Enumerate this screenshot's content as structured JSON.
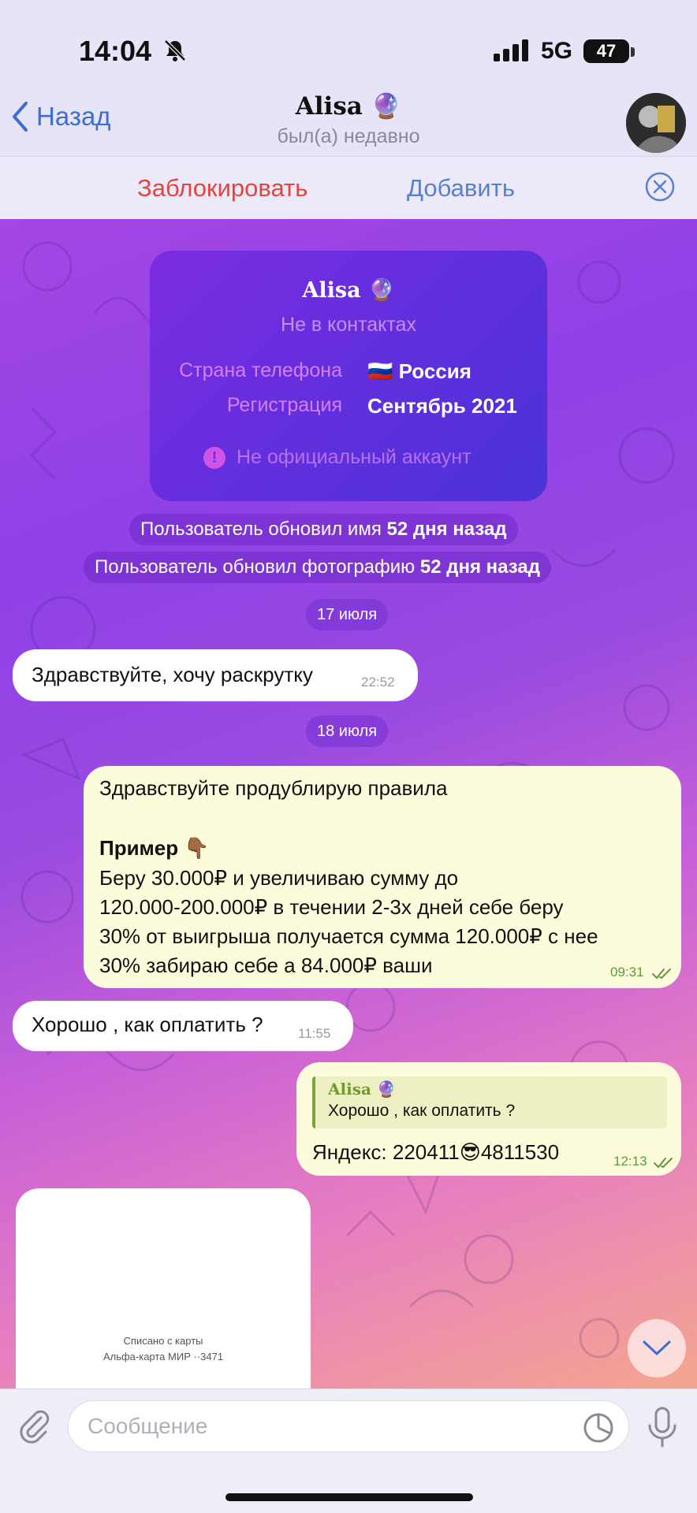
{
  "status_bar": {
    "time": "14:04",
    "network": "5G",
    "battery": "47"
  },
  "header": {
    "back_label": "Назад",
    "contact_name": "Alisa 🔮",
    "contact_status": "был(а) недавно"
  },
  "action_bar": {
    "block_label": "Заблокировать",
    "add_label": "Добавить"
  },
  "info_card": {
    "name": "Alisa 🔮",
    "subtitle": "Не в контактах",
    "phone_country_label": "Страна телефона",
    "phone_country_value": "🇷🇺 Россия",
    "registration_label": "Регистрация",
    "registration_value": "Сентябрь 2021",
    "warning": "Не официальный аккаунт"
  },
  "service_messages": [
    {
      "text": "Пользователь обновил имя ",
      "bold": "52 дня назад"
    },
    {
      "text": "Пользователь обновил фотографию ",
      "bold": "52 дня назад"
    }
  ],
  "dates": [
    "17 июля",
    "18 июля"
  ],
  "messages": [
    {
      "text": "Здравствуйте, хочу раскрутку",
      "time": "22:52"
    },
    {
      "line1": "Здравствуйте продублирую правила",
      "bold_line": "Пример 👇🏾",
      "body": "Беру 30.000₽ и увеличиваю сумму до\n120.000-200.000₽ в течении 2-3х дней себе беру\n30% от выигрыша получается сумма 120.000₽ с нее\n30% забираю себе а 84.000₽ ваши",
      "time": "09:31"
    },
    {
      "text": "Хорошо , как оплатить ?",
      "time": "11:55"
    },
    {
      "reply_name": "Alisa 🔮",
      "reply_text": "Хорошо , как оплатить ?",
      "text": "Яндекс: 220411😎4811530",
      "time": "12:13"
    }
  ],
  "receipt": {
    "line1": "Списано с карты",
    "line2": "Альфа-карта МИР ··3471"
  },
  "composer": {
    "placeholder": "Сообщение"
  },
  "colors": {
    "accent": "#3e6fd0",
    "danger": "#e0453f",
    "outgoing_bubble": "#fcfcdc"
  }
}
